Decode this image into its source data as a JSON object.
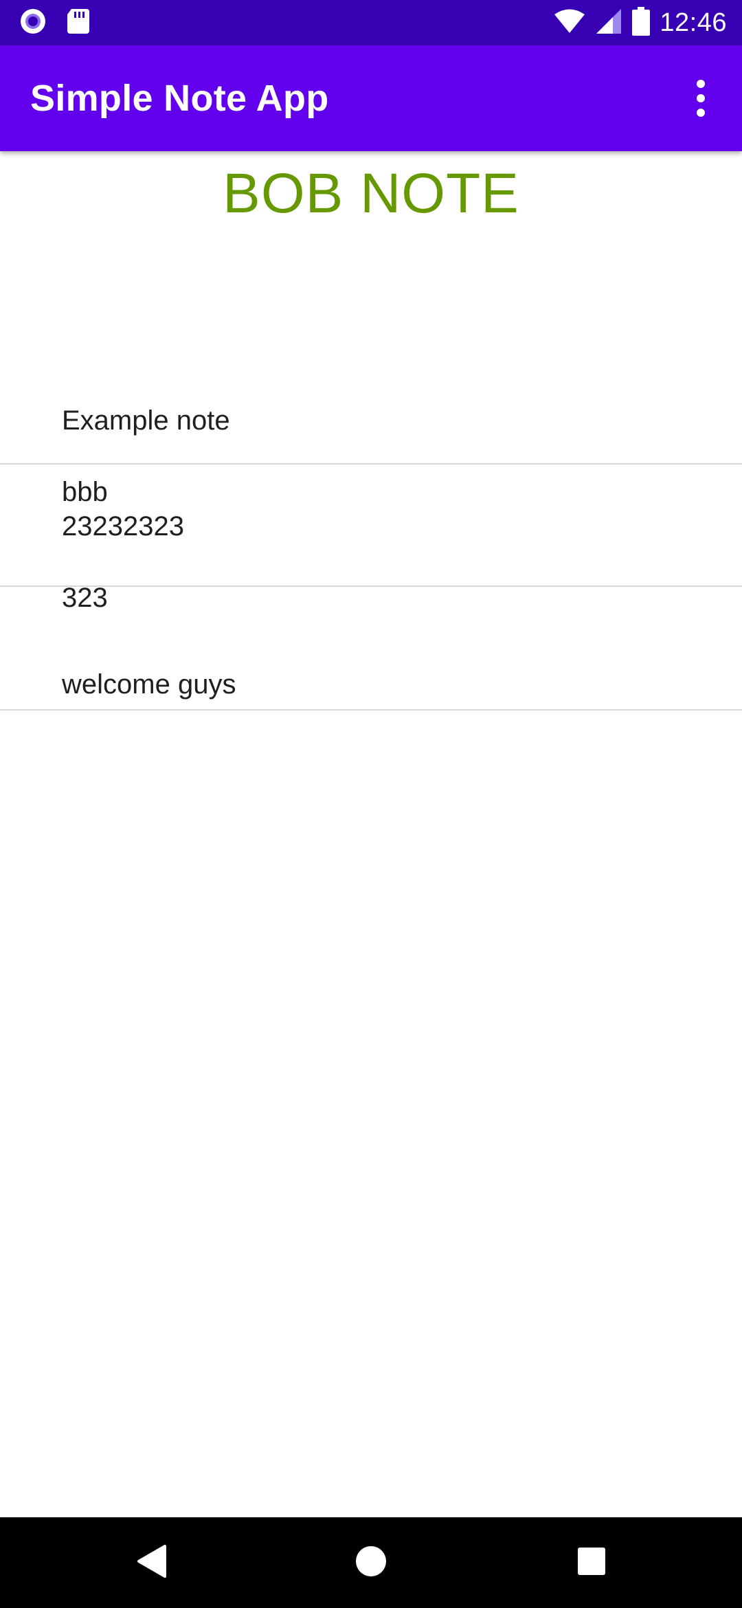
{
  "status_bar": {
    "time": "12:46",
    "icons": [
      "record-icon",
      "sd-card-icon",
      "wifi-icon",
      "signal-icon",
      "battery-icon"
    ]
  },
  "app_bar": {
    "title": "Simple Note App",
    "overflow_icon": "more-vert-icon"
  },
  "main": {
    "heading": "BOB NOTE",
    "notes": [
      {
        "line1": "Example note",
        "line2": "bbb"
      },
      {
        "line1": "23232323",
        "line2": "323"
      },
      {
        "line1": "welcome guys"
      }
    ]
  },
  "nav_bar": {
    "icons": [
      "back-icon",
      "home-icon",
      "recents-icon"
    ]
  },
  "colors": {
    "status_bar": "#3700b3",
    "app_bar": "#6200ee",
    "heading": "#669900",
    "divider": "#d9d9d9"
  }
}
